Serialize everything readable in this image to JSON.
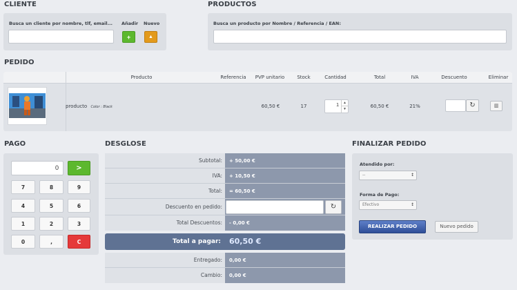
{
  "cliente": {
    "title": "CLIENTE",
    "search_label": "Busca un cliente por nombre, tlf, email...",
    "add_label": "Añadir",
    "new_label": "Nuevo",
    "add_icon": "+",
    "new_icon": "▲"
  },
  "productos": {
    "title": "PRODUCTOS",
    "search_label": "Busca un producto por Nombre / Referencia / EAN:"
  },
  "pedido": {
    "title": "PEDIDO",
    "columns": [
      "Producto",
      "Referencia",
      "PVP unitario",
      "Stock",
      "Cantidad",
      "Total",
      "IVA",
      "Descuento",
      "Eliminar"
    ],
    "row": {
      "name": "producto",
      "variant": "Color : Black",
      "pvp": "60,50 €",
      "stock": "17",
      "cantidad": "1",
      "total": "60,50 €",
      "iva": "21%",
      "descuento": ""
    }
  },
  "pago": {
    "title": "PAGO",
    "display": "0",
    "enter_label": ">",
    "keys": [
      "7",
      "8",
      "9",
      "4",
      "5",
      "6",
      "1",
      "2",
      "3",
      "0",
      ",",
      "C"
    ]
  },
  "desglose": {
    "title": "DESGLOSE",
    "subtotal_label": "Subtotal:",
    "subtotal_value": "+ 50,00 €",
    "iva_label": "IVA:",
    "iva_value": "+ 10,50 €",
    "total_label": "Total:",
    "total_value": "= 60,50 €",
    "descuento_label": "Descuento en pedido:",
    "total_desc_label": "Total Descuentos:",
    "total_desc_value": "- 0,00 €",
    "total_pagar_label": "Total a pagar:",
    "total_pagar_value": "60,50 €",
    "entregado_label": "Entregado:",
    "entregado_value": "0,00 €",
    "cambio_label": "Cambio:",
    "cambio_value": "0,00 €"
  },
  "finalizar": {
    "title": "FINALIZAR PEDIDO",
    "atendido_label": "Atendido por:",
    "atendido_value": "--",
    "forma_label": "Forma de Pago:",
    "forma_value": "Efectivo",
    "realizar_label": "REALIZAR PEDIDO",
    "nuevo_label": "Nuevo pedido"
  },
  "colors": {
    "accent_green": "#5cb82e",
    "accent_orange": "#e39a1c",
    "danger_red": "#e5393a",
    "primary_blue": "#3b5ea8",
    "total_blue": "#5f7293"
  }
}
